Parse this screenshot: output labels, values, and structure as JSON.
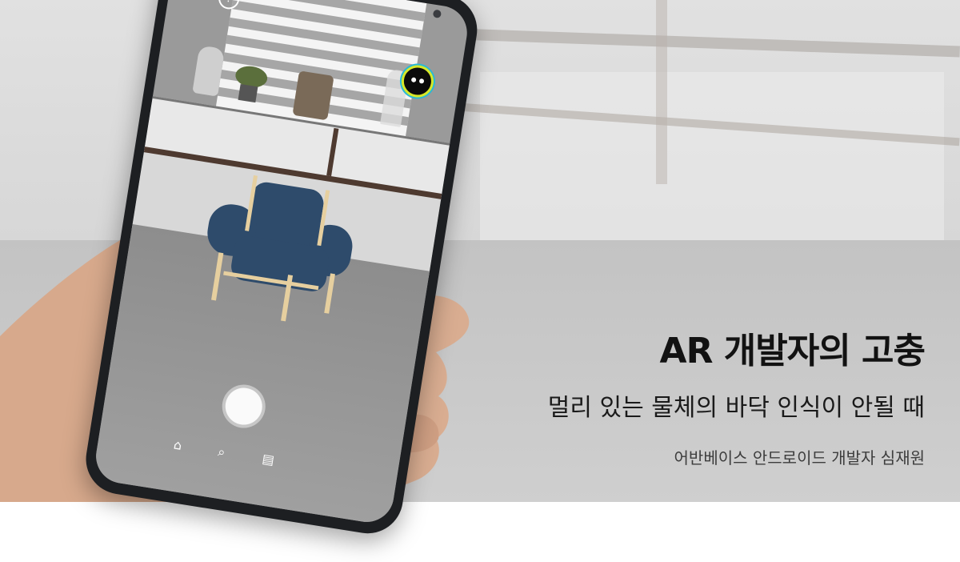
{
  "headline": {
    "title": "AR 개발자의 고충",
    "subtitle": "멀리 있는 물체의  바닥 인식이 안될 때",
    "byline": "어반베이스 안드로이드 개발자 심재원"
  },
  "ar_app": {
    "help_icon": "?",
    "profile_icon": "profile-icon",
    "capture_button": "capture-button",
    "nav": [
      {
        "name": "home-icon",
        "glyph": "⌂"
      },
      {
        "name": "search-icon",
        "glyph": "⌕"
      },
      {
        "name": "gallery-icon",
        "glyph": "▤"
      }
    ]
  },
  "colors": {
    "chair_fabric": "#2e4b6b",
    "chair_wood": "#e6cf9f",
    "profile_ring": "#d6e829",
    "profile_ring_outer": "#29b8d6"
  }
}
